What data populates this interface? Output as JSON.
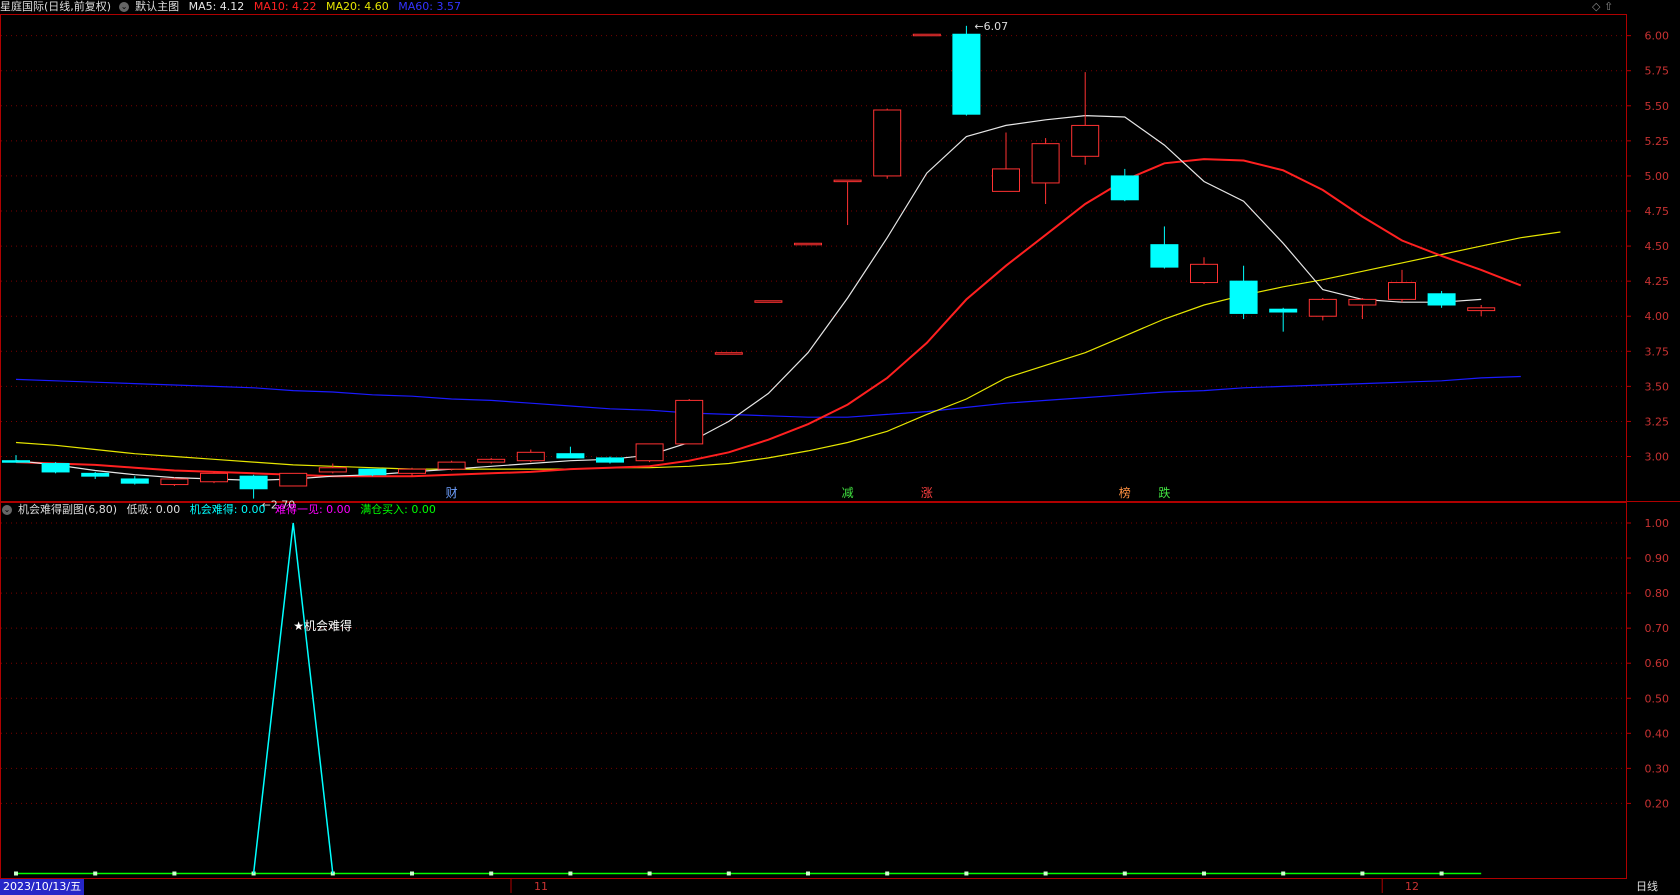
{
  "colors": {
    "background": "#000000",
    "up": "#ff3232",
    "down": "#00ffff",
    "ma5": "#e6e6e6",
    "ma10": "#ff2020",
    "ma20": "#e6e600",
    "ma60": "#1a1aff",
    "grid": "#7a0000",
    "frame": "#b00000",
    "axis_text": "#c83232",
    "sub_chance": "#00ffff",
    "sub_base": "#00ff00",
    "date_box": "#2626c8"
  },
  "main_header": {
    "stock": "星庭国际(日线,前复权)",
    "indicator": "默认主图",
    "ma5": "MA5: 4.12",
    "ma10": "MA10: 4.22",
    "ma20": "MA20: 4.60",
    "ma60": "MA60: 3.57"
  },
  "sub_header": {
    "name": "机会难得副图(6,80)",
    "low": "低吸: 0.00",
    "chance": "机会难得: 0.00",
    "rare": "难得一见: 0.00",
    "full": "满仓买入: 0.00"
  },
  "footer": {
    "date": "2023/10/13/五",
    "month_nov": "11",
    "month_dec": "12",
    "period": "日线"
  },
  "chart_data": [
    {
      "type": "candlestick",
      "yticks": [
        "6.00",
        "5.75",
        "5.50",
        "5.25",
        "5.00",
        "4.75",
        "4.50",
        "4.25",
        "4.00",
        "3.75",
        "3.50",
        "3.25",
        "3.00"
      ],
      "ylim": [
        2.69,
        6.14
      ],
      "candles": [
        {
          "o": 2.97,
          "h": 3.01,
          "l": 2.96,
          "c": 2.96
        },
        {
          "o": 2.95,
          "h": 2.96,
          "l": 2.88,
          "c": 2.89
        },
        {
          "o": 2.88,
          "h": 2.89,
          "l": 2.84,
          "c": 2.86
        },
        {
          "o": 2.84,
          "h": 2.86,
          "l": 2.8,
          "c": 2.81
        },
        {
          "o": 2.8,
          "h": 2.85,
          "l": 2.79,
          "c": 2.84
        },
        {
          "o": 2.82,
          "h": 2.89,
          "l": 2.81,
          "c": 2.88
        },
        {
          "o": 2.86,
          "h": 2.87,
          "l": 2.7,
          "c": 2.77
        },
        {
          "o": 2.79,
          "h": 2.88,
          "l": 2.79,
          "c": 2.88
        },
        {
          "o": 2.89,
          "h": 2.95,
          "l": 2.88,
          "c": 2.92
        },
        {
          "o": 2.91,
          "h": 2.91,
          "l": 2.86,
          "c": 2.87
        },
        {
          "o": 2.88,
          "h": 2.92,
          "l": 2.86,
          "c": 2.91
        },
        {
          "o": 2.91,
          "h": 2.97,
          "l": 2.9,
          "c": 2.96
        },
        {
          "o": 2.96,
          "h": 2.99,
          "l": 2.95,
          "c": 2.98
        },
        {
          "o": 2.97,
          "h": 3.05,
          "l": 2.96,
          "c": 3.03
        },
        {
          "o": 3.02,
          "h": 3.07,
          "l": 2.99,
          "c": 2.99
        },
        {
          "o": 2.99,
          "h": 3.0,
          "l": 2.95,
          "c": 2.96
        },
        {
          "o": 2.97,
          "h": 3.09,
          "l": 2.96,
          "c": 3.09
        },
        {
          "o": 3.09,
          "h": 3.41,
          "l": 3.09,
          "c": 3.4
        },
        {
          "o": 3.74,
          "h": 3.74,
          "l": 3.74,
          "c": 3.74
        },
        {
          "o": 4.11,
          "h": 4.11,
          "l": 4.11,
          "c": 4.11
        },
        {
          "o": 4.52,
          "h": 4.52,
          "l": 4.52,
          "c": 4.52
        },
        {
          "o": 4.97,
          "h": 4.97,
          "l": 4.65,
          "c": 4.97
        },
        {
          "o": 5.0,
          "h": 5.48,
          "l": 4.98,
          "c": 5.47
        },
        {
          "o": 6.01,
          "h": 6.01,
          "l": 6.01,
          "c": 6.01
        },
        {
          "o": 6.01,
          "h": 6.07,
          "l": 5.43,
          "c": 5.44
        },
        {
          "o": 4.89,
          "h": 5.31,
          "l": 4.89,
          "c": 5.05
        },
        {
          "o": 4.95,
          "h": 5.27,
          "l": 4.8,
          "c": 5.23
        },
        {
          "o": 5.14,
          "h": 5.74,
          "l": 5.08,
          "c": 5.36
        },
        {
          "o": 5.0,
          "h": 5.05,
          "l": 4.82,
          "c": 4.83
        },
        {
          "o": 4.51,
          "h": 4.64,
          "l": 4.34,
          "c": 4.35
        },
        {
          "o": 4.24,
          "h": 4.42,
          "l": 4.23,
          "c": 4.37
        },
        {
          "o": 4.25,
          "h": 4.36,
          "l": 3.98,
          "c": 4.02
        },
        {
          "o": 4.05,
          "h": 4.06,
          "l": 3.89,
          "c": 4.03
        },
        {
          "o": 4.0,
          "h": 4.13,
          "l": 3.97,
          "c": 4.12
        },
        {
          "o": 4.08,
          "h": 4.13,
          "l": 3.98,
          "c": 4.12
        },
        {
          "o": 4.12,
          "h": 4.33,
          "l": 4.1,
          "c": 4.24
        },
        {
          "o": 4.16,
          "h": 4.18,
          "l": 4.06,
          "c": 4.08
        },
        {
          "o": 4.04,
          "h": 4.08,
          "l": 4.0,
          "c": 4.06
        }
      ],
      "ma5": [
        2.97,
        2.94,
        2.9,
        2.87,
        2.85,
        2.84,
        2.83,
        2.84,
        2.86,
        2.87,
        2.89,
        2.91,
        2.93,
        2.95,
        2.97,
        2.98,
        3.01,
        3.1,
        3.25,
        3.45,
        3.74,
        4.13,
        4.56,
        5.02,
        5.28,
        5.36,
        5.4,
        5.43,
        5.42,
        5.22,
        4.96,
        4.82,
        4.52,
        4.19,
        4.12,
        4.1,
        4.1,
        4.12
      ],
      "ma10": [
        2.96,
        2.95,
        2.94,
        2.92,
        2.9,
        2.89,
        2.88,
        2.87,
        2.86,
        2.86,
        2.86,
        2.87,
        2.88,
        2.89,
        2.91,
        2.92,
        2.93,
        2.97,
        3.03,
        3.12,
        3.23,
        3.37,
        3.56,
        3.81,
        4.12,
        4.36,
        4.58,
        4.8,
        4.97,
        5.09,
        5.12,
        5.11,
        5.04,
        4.9,
        4.71,
        4.54,
        4.43,
        4.33,
        4.22
      ],
      "ma20": [
        3.1,
        3.08,
        3.05,
        3.02,
        3.0,
        2.98,
        2.96,
        2.94,
        2.93,
        2.92,
        2.91,
        2.91,
        2.91,
        2.91,
        2.91,
        2.92,
        2.92,
        2.93,
        2.95,
        2.99,
        3.04,
        3.1,
        3.18,
        3.3,
        3.41,
        3.56,
        3.65,
        3.74,
        3.86,
        3.98,
        4.08,
        4.15,
        4.21,
        4.26,
        4.32,
        4.38,
        4.44,
        4.5,
        4.56,
        4.6
      ],
      "ma60": [
        3.55,
        3.54,
        3.53,
        3.52,
        3.51,
        3.5,
        3.49,
        3.47,
        3.46,
        3.44,
        3.43,
        3.41,
        3.4,
        3.38,
        3.36,
        3.34,
        3.33,
        3.31,
        3.3,
        3.29,
        3.28,
        3.28,
        3.3,
        3.32,
        3.35,
        3.38,
        3.4,
        3.42,
        3.44,
        3.46,
        3.47,
        3.49,
        3.5,
        3.51,
        3.52,
        3.53,
        3.54,
        3.56,
        3.57
      ],
      "high_label": "6.07",
      "low_label": "2.70",
      "events": [
        {
          "i": 11,
          "text": "财",
          "color": "#6ea0ff"
        },
        {
          "i": 21,
          "text": "减",
          "color": "#40e040"
        },
        {
          "i": 23,
          "text": "涨",
          "color": "#ff4040"
        },
        {
          "i": 28,
          "text": "榜",
          "color": "#ff9040"
        },
        {
          "i": 29,
          "text": "跌",
          "color": "#40e040"
        }
      ]
    },
    {
      "type": "line",
      "yticks": [
        "1.00",
        "0.90",
        "0.80",
        "0.70",
        "0.60",
        "0.50",
        "0.40",
        "0.30",
        "0.20"
      ],
      "ylim": [
        -0.01,
        1.02
      ],
      "chance_peak": {
        "i": 7,
        "value": 1.0
      },
      "chance_label": "★机会难得",
      "baseline": 0
    }
  ]
}
